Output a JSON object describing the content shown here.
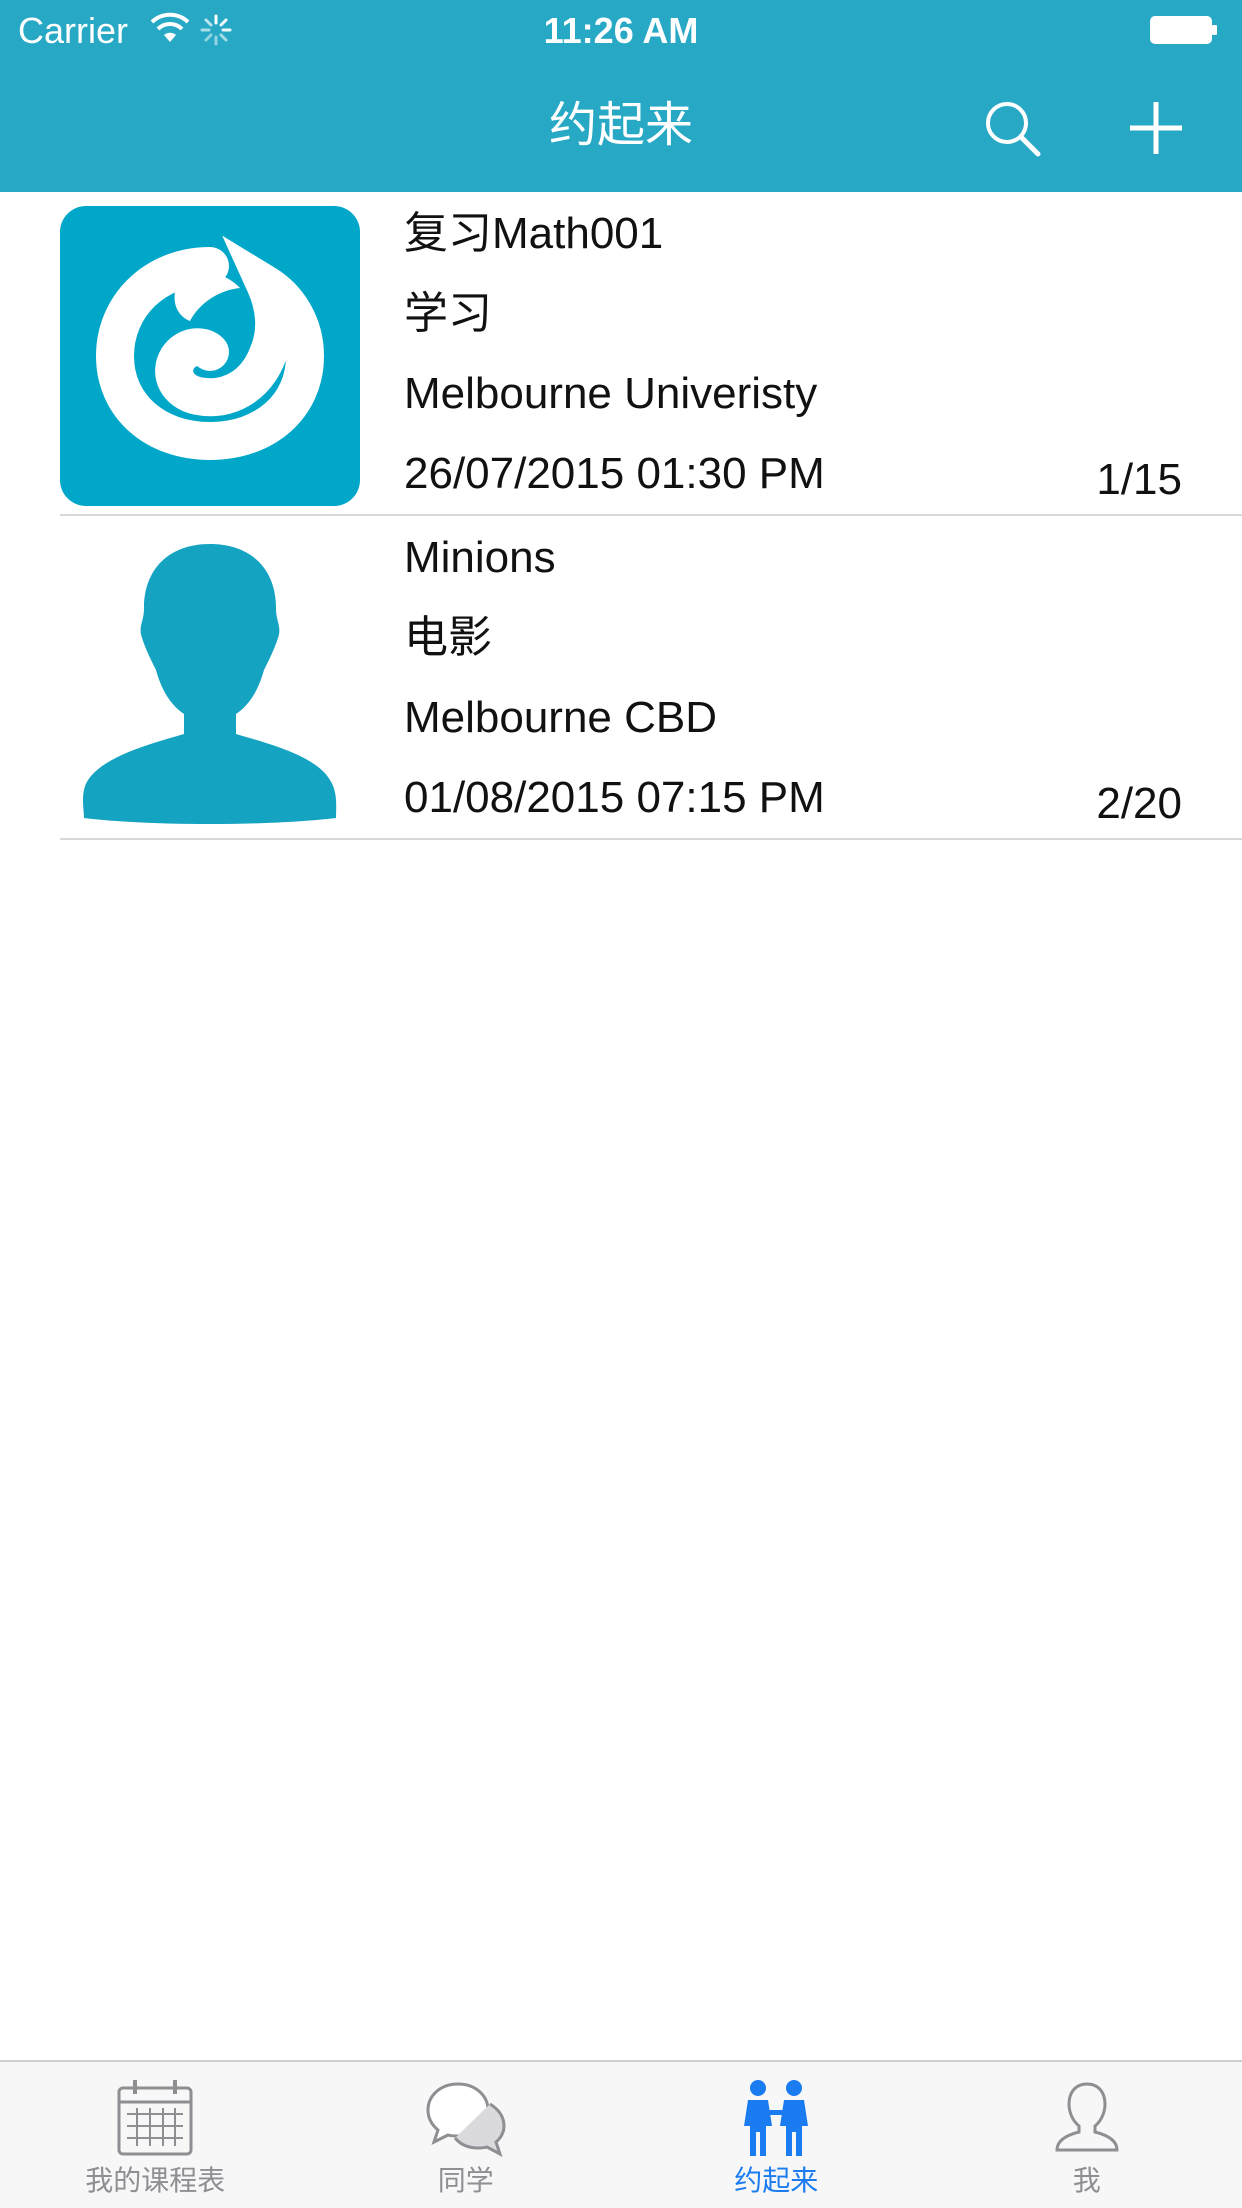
{
  "status_bar": {
    "carrier": "Carrier",
    "time": "11:26 AM"
  },
  "nav": {
    "title": "约起来",
    "icons": {
      "search": "search-icon",
      "add": "plus-icon"
    }
  },
  "events": [
    {
      "title": "复习Math001",
      "category": "学习",
      "location": "Melbourne Univeristy",
      "datetime": "26/07/2015 01:30 PM",
      "count": "1/15",
      "thumbnail": "app-logo"
    },
    {
      "title": "Minions",
      "category": "电影",
      "location": "Melbourne CBD",
      "datetime": "01/08/2015 07:15 PM",
      "count": "2/20",
      "thumbnail": "default-avatar"
    }
  ],
  "tabs": [
    {
      "label": "我的课程表",
      "icon": "calendar-icon",
      "active": false
    },
    {
      "label": "同学",
      "icon": "chat-bubbles-icon",
      "active": false
    },
    {
      "label": "约起来",
      "icon": "people-icon",
      "active": true
    },
    {
      "label": "我",
      "icon": "person-icon",
      "active": false
    }
  ],
  "colors": {
    "nav_background": "#27a9c5",
    "thumbnail_accent": "#00a7c8",
    "tab_active": "#1a7cf0",
    "tab_inactive": "#8e8e93"
  }
}
